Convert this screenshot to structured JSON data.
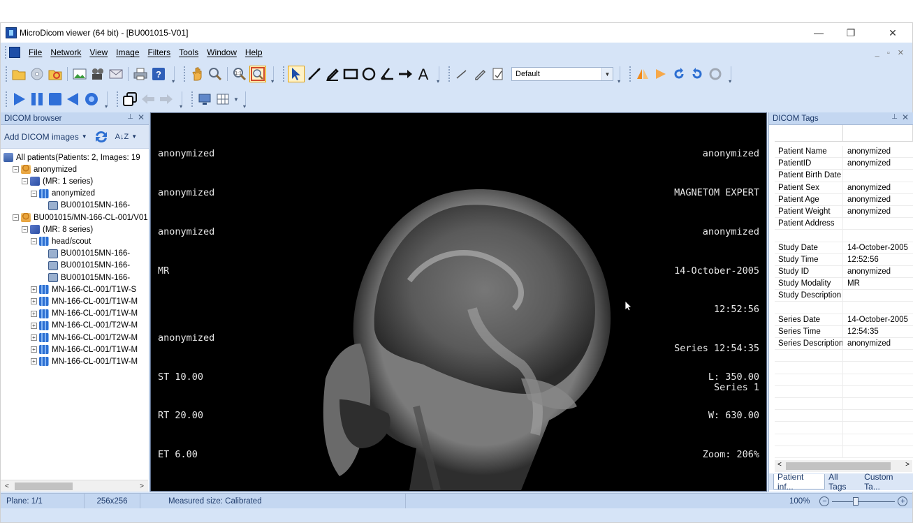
{
  "window": {
    "title": "MicroDicom viewer (64 bit) - [BU001015-V01]",
    "controls": {
      "minimize": "—",
      "restore": "❐",
      "close": "✕"
    }
  },
  "menu": [
    {
      "label": "File"
    },
    {
      "label": "Network"
    },
    {
      "label": "View"
    },
    {
      "label": "Image"
    },
    {
      "label": "Filters"
    },
    {
      "label": "Tools"
    },
    {
      "label": "Window"
    },
    {
      "label": "Help"
    }
  ],
  "mdi_controls": "_ ▫ ✕",
  "toolbar": {
    "preset_combo": "Default"
  },
  "dicom_browser": {
    "title": "DICOM browser",
    "add_button": "Add DICOM images",
    "sort_label": "A↓Z",
    "tree": [
      {
        "label": "All patients(Patients: 2, Images: 19",
        "level": 0,
        "icon": "root"
      },
      {
        "label": "anonymized",
        "level": 1,
        "icon": "patient"
      },
      {
        "label": "(MR: 1 series)",
        "level": 2,
        "icon": "study"
      },
      {
        "label": "anonymized",
        "level": 3,
        "icon": "series"
      },
      {
        "label": "BU001015MN-166-",
        "level": 4,
        "icon": "image"
      },
      {
        "label": "BU001015/MN-166-CL-001/V01",
        "level": 1,
        "icon": "patient"
      },
      {
        "label": "(MR: 8 series)",
        "level": 2,
        "icon": "study"
      },
      {
        "label": "head/scout",
        "level": 3,
        "icon": "series"
      },
      {
        "label": "BU001015MN-166-",
        "level": 4,
        "icon": "image"
      },
      {
        "label": "BU001015MN-166-",
        "level": 4,
        "icon": "image"
      },
      {
        "label": "BU001015MN-166-",
        "level": 4,
        "icon": "image"
      },
      {
        "label": "MN-166-CL-001/T1W-S",
        "level": 3,
        "icon": "series"
      },
      {
        "label": "MN-166-CL-001/T1W-M",
        "level": 3,
        "icon": "series"
      },
      {
        "label": "MN-166-CL-001/T1W-M",
        "level": 3,
        "icon": "series"
      },
      {
        "label": "MN-166-CL-001/T2W-M",
        "level": 3,
        "icon": "series"
      },
      {
        "label": "MN-166-CL-001/T2W-M",
        "level": 3,
        "icon": "series"
      },
      {
        "label": "MN-166-CL-001/T1W-M",
        "level": 3,
        "icon": "series"
      },
      {
        "label": "MN-166-CL-001/T1W-M",
        "level": 3,
        "icon": "series"
      }
    ]
  },
  "viewer": {
    "top_left": [
      "anonymized",
      "anonymized",
      "anonymized",
      "MR"
    ],
    "top_right": [
      "anonymized",
      "MAGNETOM EXPERT",
      "anonymized",
      "14-October-2005",
      "12:52:56",
      "Series 12:54:35",
      "Series 1"
    ],
    "bottom_left": [
      "anonymized",
      "ST 10.00",
      "RT 20.00",
      "ET 6.00"
    ],
    "bottom_right": [
      "L: 350.00",
      "W: 630.00",
      "Zoom: 206%"
    ]
  },
  "dicom_tags": {
    "title": "DICOM Tags",
    "rows": [
      {
        "key": "Patient Name",
        "value": "anonymized"
      },
      {
        "key": "PatientID",
        "value": "anonymized"
      },
      {
        "key": "Patient Birth Date",
        "value": ""
      },
      {
        "key": "Patient Sex",
        "value": "anonymized"
      },
      {
        "key": "Patient Age",
        "value": "anonymized"
      },
      {
        "key": "Patient Weight",
        "value": "anonymized"
      },
      {
        "key": "Patient Address",
        "value": ""
      },
      {
        "key": "",
        "value": ""
      },
      {
        "key": "Study Date",
        "value": "14-October-2005"
      },
      {
        "key": "Study Time",
        "value": "12:52:56"
      },
      {
        "key": "Study ID",
        "value": "anonymized"
      },
      {
        "key": "Study Modality",
        "value": "MR"
      },
      {
        "key": "Study Description",
        "value": ""
      },
      {
        "key": "",
        "value": ""
      },
      {
        "key": "Series Date",
        "value": "14-October-2005"
      },
      {
        "key": "Series Time",
        "value": "12:54:35"
      },
      {
        "key": "Series Description",
        "value": "anonymized"
      }
    ],
    "tabs": [
      {
        "label": "Patient inf..."
      },
      {
        "label": "All Tags"
      },
      {
        "label": "Custom Ta..."
      }
    ]
  },
  "statusbar": {
    "plane": "Plane: 1/1",
    "size": "256x256",
    "measured": "Measured size: Calibrated",
    "zoom": "100%"
  },
  "colors": {
    "chrome": "#d6e4f7",
    "panel_header": "#c4d7f1",
    "accent": "#1d4fa8"
  }
}
